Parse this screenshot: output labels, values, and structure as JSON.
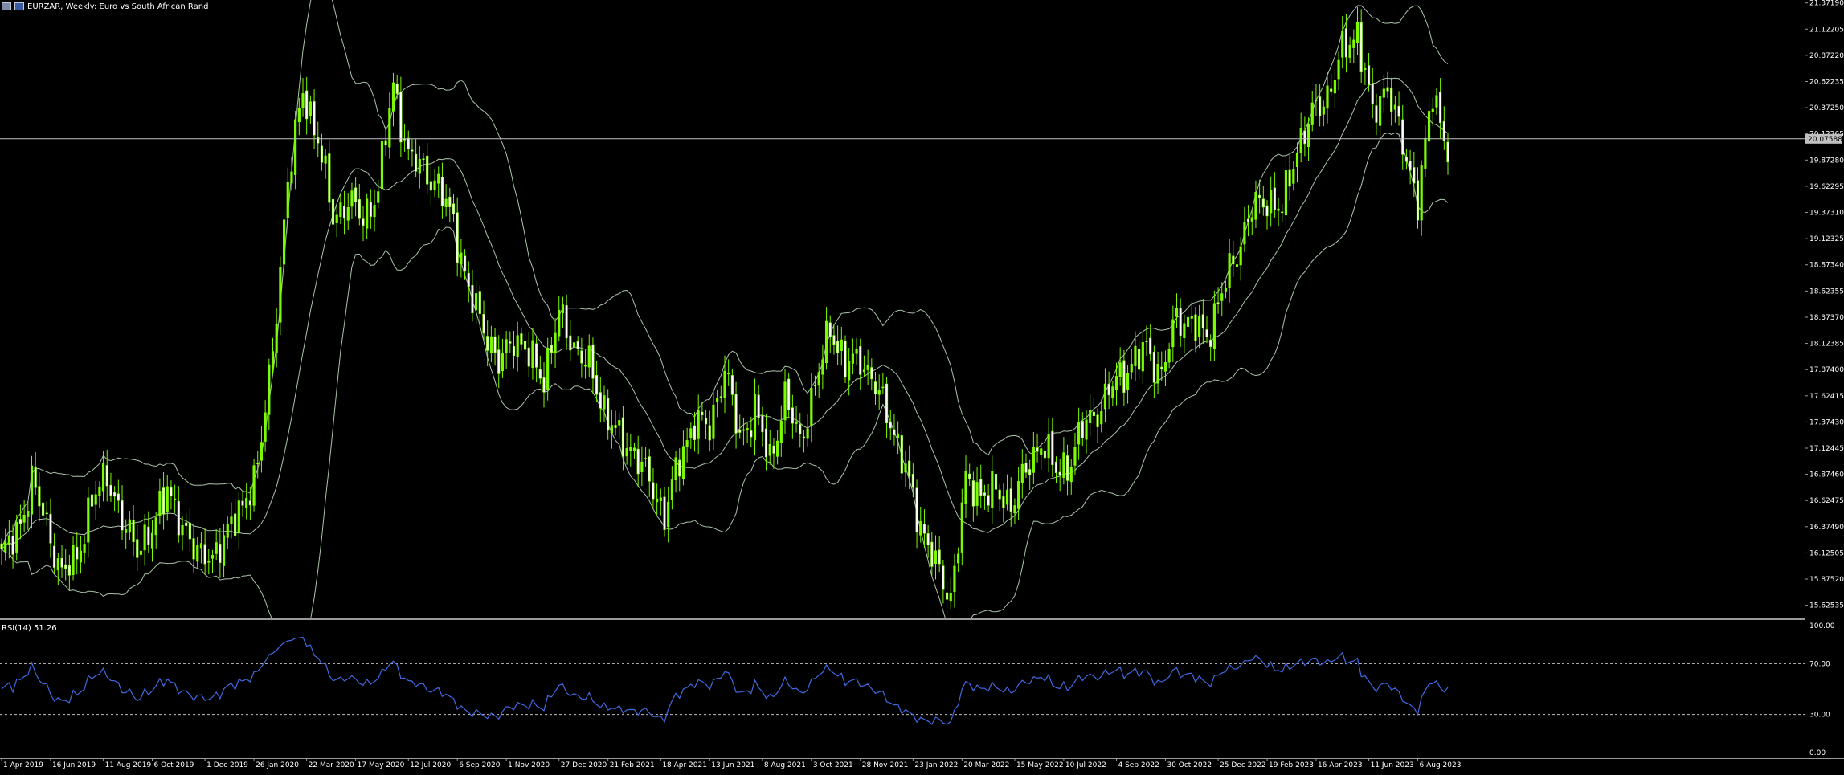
{
  "header": {
    "title": "EURZAR, Weekly:  Euro vs South African Rand",
    "icons": [
      "chart-bars-icon",
      "chart-type-icon"
    ]
  },
  "indicator": {
    "label": "RSI(14) 51.26"
  },
  "colors": {
    "background": "#000000",
    "bull": "#7CFC00",
    "bear": "#FFFFFF",
    "bands": "#c8e6c8",
    "rsi": "#4169e1",
    "axis_text": "#ffffff",
    "grid": "#808080"
  },
  "chart_data": [
    {
      "type": "candlestick",
      "title": "EURZAR, Weekly:  Euro vs South African Rand",
      "ylim": [
        15.5,
        21.4
      ],
      "y_ticks": [
        "21.37190",
        "21.12205",
        "20.87220",
        "20.62235",
        "20.37250",
        "20.12265",
        "19.87280",
        "19.62295",
        "19.37310",
        "19.12325",
        "18.87340",
        "18.62355",
        "18.37370",
        "18.12385",
        "17.87400",
        "17.62415",
        "17.37430",
        "17.12445",
        "16.87460",
        "16.62475",
        "16.37490",
        "16.12505",
        "15.87520",
        "15.62535"
      ],
      "current_price": "20.07588",
      "current_price_value": 20.07588,
      "x_labels": [
        "1 Apr 2019",
        "16 Jun 2019",
        "11 Aug 2019",
        "6 Oct 2019",
        "1 Dec 2019",
        "26 Jan 2020",
        "22 Mar 2020",
        "17 May 2020",
        "12 Jul 2020",
        "6 Sep 2020",
        "1 Nov 2020",
        "27 Dec 2020",
        "21 Feb 2021",
        "18 Apr 2021",
        "13 Jun 2021",
        "8 Aug 2021",
        "3 Oct 2021",
        "28 Nov 2021",
        "23 Jan 2022",
        "20 Mar 2022",
        "15 May 2022",
        "10 Jul 2022",
        "4 Sep 2022",
        "30 Oct 2022",
        "25 Dec 2022",
        "19 Feb 2023",
        "16 Apr 2023",
        "11 Jun 2023",
        "6 Aug 2023"
      ],
      "close_anchors": [
        [
          0,
          16.1
        ],
        [
          4,
          16.3
        ],
        [
          8,
          16.8
        ],
        [
          12,
          16.4
        ],
        [
          16,
          15.9
        ],
        [
          20,
          16.1
        ],
        [
          24,
          16.6
        ],
        [
          28,
          16.9
        ],
        [
          32,
          16.4
        ],
        [
          36,
          16.2
        ],
        [
          40,
          16.3
        ],
        [
          44,
          16.8
        ],
        [
          48,
          16.3
        ],
        [
          52,
          16.2
        ],
        [
          56,
          16.0
        ],
        [
          60,
          16.4
        ],
        [
          64,
          16.5
        ],
        [
          68,
          17.0
        ],
        [
          72,
          18.0
        ],
        [
          76,
          19.7
        ],
        [
          80,
          20.5
        ],
        [
          84,
          20.1
        ],
        [
          88,
          19.3
        ],
        [
          92,
          19.5
        ],
        [
          96,
          19.3
        ],
        [
          100,
          19.6
        ],
        [
          104,
          20.6
        ],
        [
          108,
          19.9
        ],
        [
          112,
          19.8
        ],
        [
          116,
          19.6
        ],
        [
          120,
          19.3
        ],
        [
          124,
          18.6
        ],
        [
          128,
          18.3
        ],
        [
          132,
          17.9
        ],
        [
          136,
          18.2
        ],
        [
          140,
          18.0
        ],
        [
          144,
          17.8
        ],
        [
          148,
          18.4
        ],
        [
          152,
          18.1
        ],
        [
          156,
          17.9
        ],
        [
          160,
          17.5
        ],
        [
          164,
          17.2
        ],
        [
          168,
          17.1
        ],
        [
          172,
          16.8
        ],
        [
          176,
          16.5
        ],
        [
          180,
          17.0
        ],
        [
          184,
          17.4
        ],
        [
          188,
          17.3
        ],
        [
          192,
          17.9
        ],
        [
          196,
          17.2
        ],
        [
          200,
          17.5
        ],
        [
          204,
          17.0
        ],
        [
          208,
          17.6
        ],
        [
          212,
          17.2
        ],
        [
          216,
          17.7
        ],
        [
          220,
          18.3
        ],
        [
          224,
          17.9
        ],
        [
          228,
          18.0
        ],
        [
          232,
          17.7
        ],
        [
          236,
          17.4
        ],
        [
          240,
          16.9
        ],
        [
          244,
          16.4
        ],
        [
          248,
          16.0
        ],
        [
          252,
          15.7
        ],
        [
          256,
          16.8
        ],
        [
          260,
          16.7
        ],
        [
          264,
          16.7
        ],
        [
          268,
          16.6
        ],
        [
          272,
          16.9
        ],
        [
          276,
          17.2
        ],
        [
          280,
          16.9
        ],
        [
          284,
          17.0
        ],
        [
          288,
          17.4
        ],
        [
          292,
          17.5
        ],
        [
          296,
          17.8
        ],
        [
          300,
          17.9
        ],
        [
          304,
          18.1
        ],
        [
          308,
          17.8
        ],
        [
          312,
          18.4
        ],
        [
          316,
          18.3
        ],
        [
          320,
          18.2
        ],
        [
          324,
          18.6
        ],
        [
          328,
          19.0
        ],
        [
          332,
          19.4
        ],
        [
          336,
          19.5
        ],
        [
          340,
          19.4
        ],
        [
          344,
          20.0
        ],
        [
          348,
          20.3
        ],
        [
          352,
          20.5
        ],
        [
          356,
          20.9
        ],
        [
          360,
          21.1
        ],
        [
          364,
          20.3
        ],
        [
          368,
          20.6
        ],
        [
          372,
          20.0
        ],
        [
          376,
          19.5
        ],
        [
          380,
          20.5
        ],
        [
          384,
          20.0
        ]
      ],
      "bollinger": {
        "period": 20,
        "deviations": 2
      }
    },
    {
      "type": "line",
      "title": "RSI(14) 51.26",
      "ylim": [
        0,
        100
      ],
      "y_ticks": [
        "100.00",
        "70.00",
        "30.00",
        "0.00"
      ],
      "levels": [
        70,
        30
      ],
      "last_value": 51.26
    }
  ]
}
